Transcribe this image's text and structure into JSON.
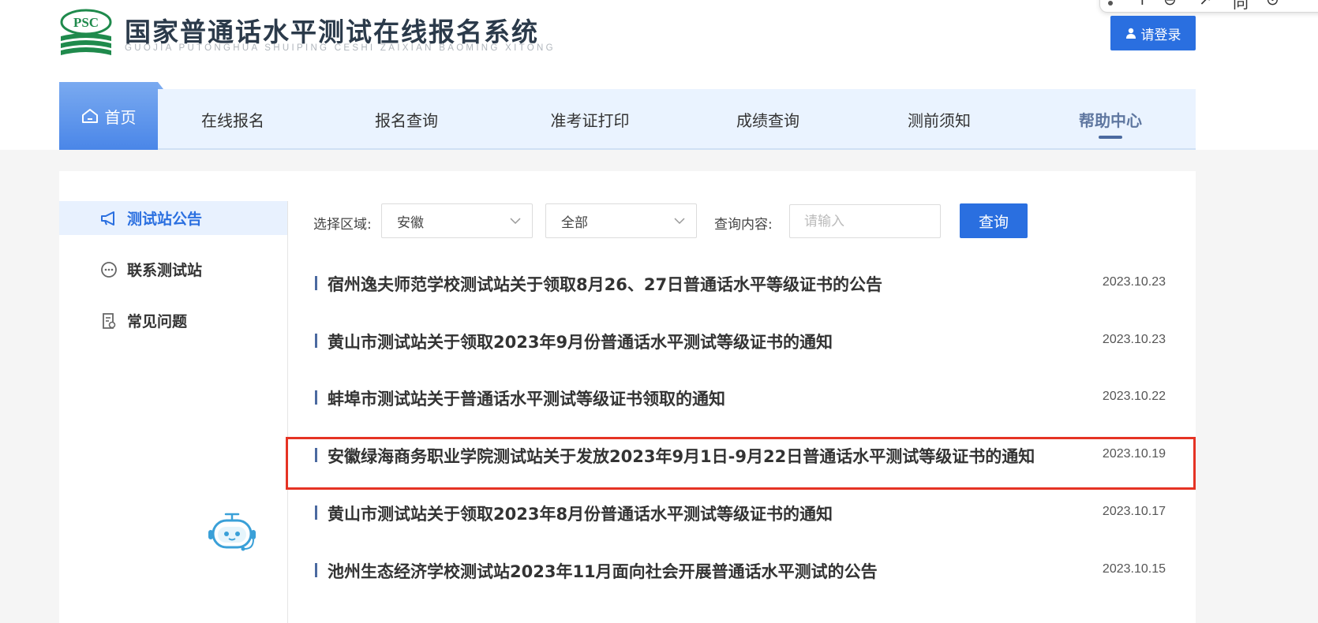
{
  "header": {
    "logo_text": "PSC",
    "title": "国家普通话水平测试在线报名系统",
    "subtitle": "GUOJIA PUTONGHUA SHUIPING CESHI ZAIXIAN BAOMING XITONG",
    "login_label": "请登录"
  },
  "toolbar": {
    "glyphs": [
      "↑",
      "⊖",
      "↗",
      "同",
      "⊙"
    ]
  },
  "nav": {
    "items": [
      {
        "label": "首页",
        "active": false,
        "highlighted": true
      },
      {
        "label": "在线报名"
      },
      {
        "label": "报名查询"
      },
      {
        "label": "准考证打印"
      },
      {
        "label": "成绩查询"
      },
      {
        "label": "测前须知"
      },
      {
        "label": "帮助中心",
        "active": true
      }
    ]
  },
  "sidebar": {
    "items": [
      {
        "label": "测试站公告",
        "icon": "megaphone-icon",
        "active": true
      },
      {
        "label": "联系测试站",
        "icon": "chat-icon"
      },
      {
        "label": "常见问题",
        "icon": "faq-document-icon"
      }
    ]
  },
  "filters": {
    "region_label": "选择区域:",
    "region_value": "安徽",
    "category_value": "全部",
    "query_label": "查询内容:",
    "query_placeholder": "请输入",
    "query_button": "查询"
  },
  "notices": [
    {
      "title": "宿州逸夫师范学校测试站关于领取8月26、27日普通话水平等级证书的公告",
      "date": "2023.10.23"
    },
    {
      "title": "黄山市测试站关于领取2023年9月份普通话水平测试等级证书的通知",
      "date": "2023.10.23"
    },
    {
      "title": "蚌埠市测试站关于普通话水平测试等级证书领取的通知",
      "date": "2023.10.22"
    },
    {
      "title": "安徽绿海商务职业学院测试站关于发放2023年9月1日-9月22日普通话水平测试等级证书的通知",
      "date": "2023.10.19",
      "highlighted": true
    },
    {
      "title": "黄山市测试站关于领取2023年8月份普通话水平测试等级证书的通知",
      "date": "2023.10.17"
    },
    {
      "title": "池州生态经济学校测试站2023年11月面向社会开展普通话水平测试的公告",
      "date": "2023.10.15"
    }
  ],
  "colors": {
    "brand_blue": "#2a6fe0",
    "logo_green": "#1f8a4c",
    "nav_bg": "#eaf3ff",
    "highlight_red": "#e53324"
  }
}
